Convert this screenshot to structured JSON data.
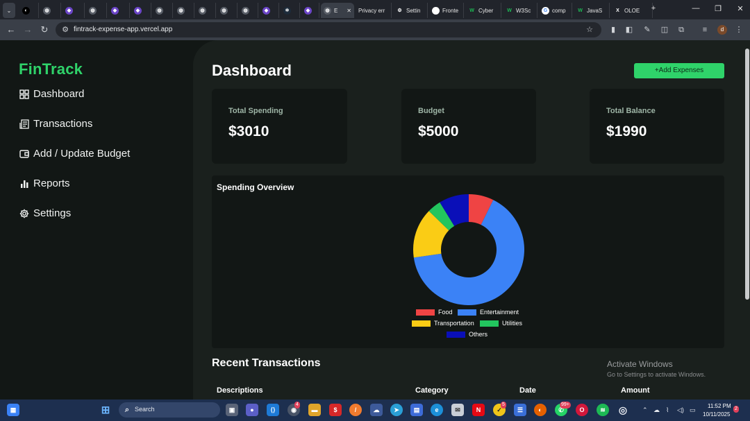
{
  "browser": {
    "tabs": [
      {
        "label": "",
        "icon": "github-icon"
      },
      {
        "label": "",
        "icon": "globe-icon"
      },
      {
        "label": "",
        "icon": "app-icon"
      },
      {
        "label": "",
        "icon": "globe-icon"
      },
      {
        "label": "",
        "icon": "app-icon"
      },
      {
        "label": "",
        "icon": "app-icon"
      },
      {
        "label": "",
        "icon": "globe-icon"
      },
      {
        "label": "",
        "icon": "globe-icon"
      },
      {
        "label": "",
        "icon": "globe-icon"
      },
      {
        "label": "",
        "icon": "globe-icon"
      },
      {
        "label": "",
        "icon": "globe-icon"
      },
      {
        "label": "",
        "icon": "app-icon"
      },
      {
        "label": "",
        "icon": "react-icon"
      },
      {
        "label": "",
        "icon": "app-icon"
      },
      {
        "label": "E",
        "icon": "globe-icon",
        "active": true
      },
      {
        "label": "Privacy err",
        "icon": ""
      },
      {
        "label": "Settin",
        "icon": "gear-icon"
      },
      {
        "label": "Fronte",
        "icon": "page-icon"
      },
      {
        "label": "Cyber",
        "icon": "w-icon"
      },
      {
        "label": "W3Sc",
        "icon": "w-icon"
      },
      {
        "label": "comp",
        "icon": "google-icon"
      },
      {
        "label": "JavaS",
        "icon": "w-icon"
      },
      {
        "label": "OLOE",
        "icon": "x-icon"
      }
    ],
    "url": "fintrack-expense-app.vercel.app"
  },
  "app": {
    "brand": "FinTrack",
    "nav": [
      {
        "label": "Dashboard",
        "icon": "dashboard-icon"
      },
      {
        "label": "Transactions",
        "icon": "receipt-icon"
      },
      {
        "label": "Add / Update Budget",
        "icon": "wallet-icon"
      },
      {
        "label": "Reports",
        "icon": "bar-chart-icon"
      },
      {
        "label": "Settings",
        "icon": "gear-icon"
      }
    ],
    "page_title": "Dashboard",
    "add_button": "+Add Expenses",
    "cards": [
      {
        "label": "Total Spending",
        "value": "$3010"
      },
      {
        "label": "Budget",
        "value": "$5000"
      },
      {
        "label": "Total Balance",
        "value": "$1990"
      }
    ],
    "overview_title": "Spending Overview",
    "recent_title": "Recent Transactions",
    "table_headers": [
      "Descriptions",
      "Category",
      "Date",
      "Amount"
    ],
    "activate": {
      "line1": "Activate Windows",
      "line2": "Go to Settings to activate Windows."
    }
  },
  "chart_data": {
    "type": "pie",
    "variant": "doughnut",
    "title": "Spending Overview",
    "categories": [
      "Food",
      "Entertainment",
      "Transportation",
      "Utilities",
      "Others"
    ],
    "values": [
      200,
      1800,
      400,
      110,
      240
    ],
    "colors": [
      "#ef4444",
      "#3b82f6",
      "#facc15",
      "#22c55e",
      "#0a0fb8"
    ],
    "legend": "bottom"
  },
  "taskbar": {
    "search": "Search",
    "time": "11:52 PM",
    "date": "10/11/2025",
    "badges": {
      "whatsapp": "99+",
      "notifications": "2",
      "chrome": "4",
      "norton": "5"
    }
  }
}
